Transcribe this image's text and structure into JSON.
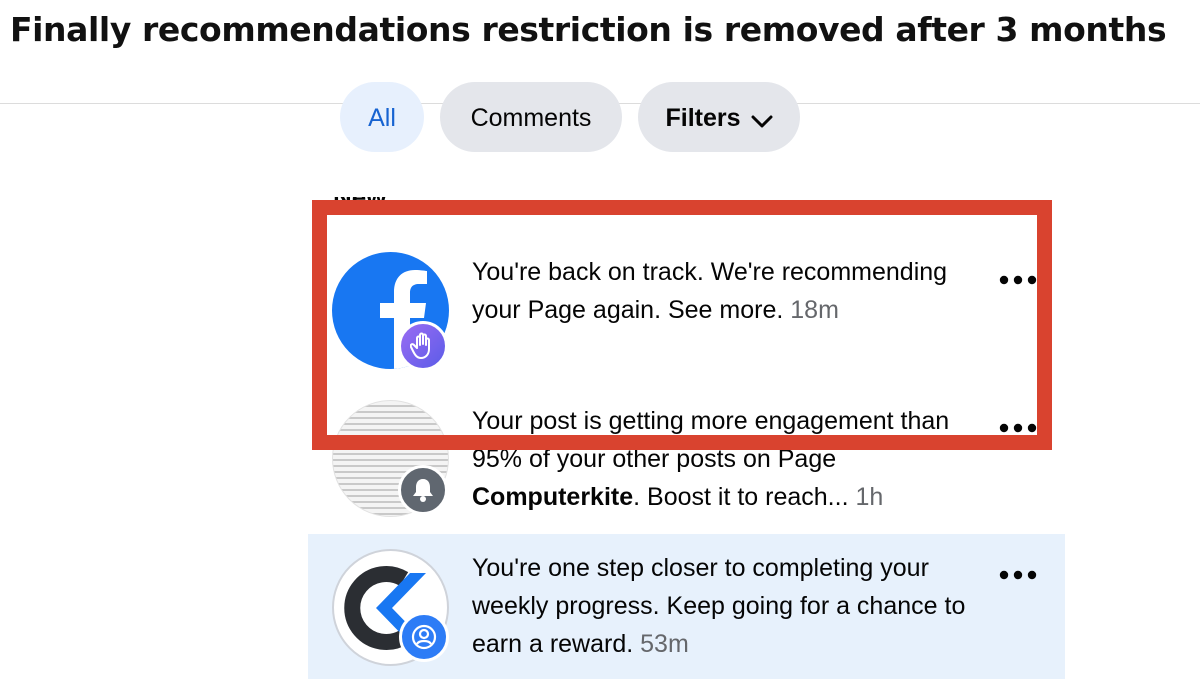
{
  "headline": "Finally recommendations restriction is removed after 3 months",
  "filters": {
    "all_label": "All",
    "comments_label": "Comments",
    "filters_label": "Filters"
  },
  "section_label": "New",
  "notifications": [
    {
      "text": "You're back on track. We're recommending your Page again. See more.",
      "time": "18m",
      "avatar_icon": "facebook-logo-icon",
      "badge_icon": "raised-hand-icon"
    },
    {
      "text_before": "Your post is getting more engagement than 95% of your other posts on Page ",
      "page_name": "Computerkite",
      "text_after": ". Boost it to reach...",
      "time": "1h",
      "avatar_icon": "post-thumbnail",
      "badge_icon": "bell-icon"
    },
    {
      "text": "You're one step closer to completing your weekly progress. Keep going for a chance to earn a reward.",
      "time": "53m",
      "avatar_icon": "computerkite-logo-icon",
      "badge_icon": "person-icon"
    }
  ],
  "colors": {
    "facebook_blue": "#1877f2",
    "highlight_red": "#d9432f",
    "badge_purple": "#7b5cf0",
    "unread_bg": "#e7f1fc"
  }
}
